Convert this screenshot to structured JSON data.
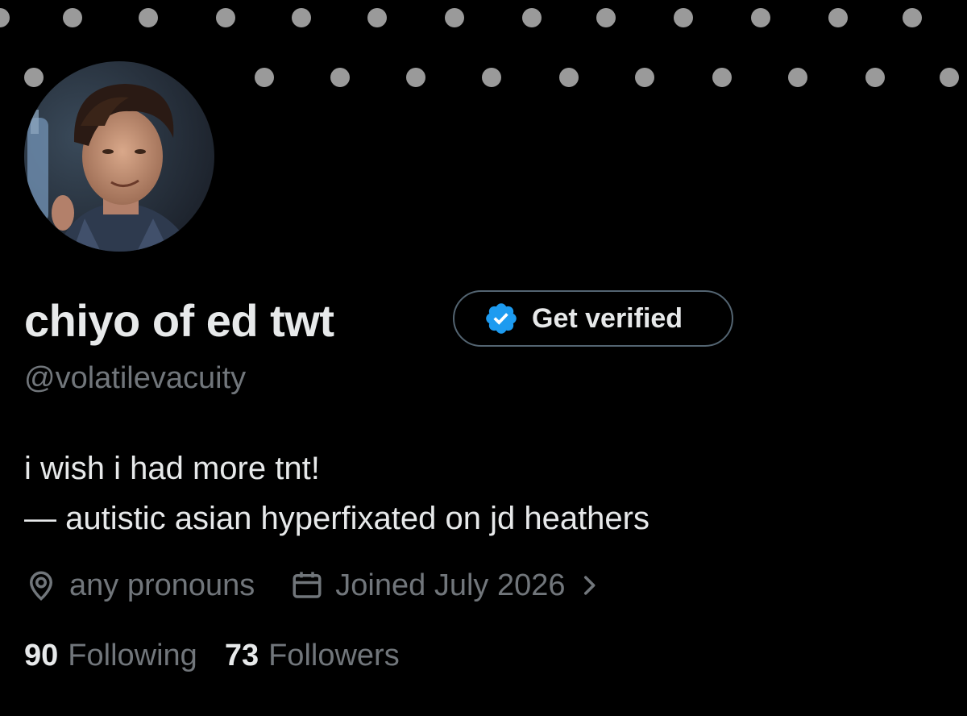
{
  "profile": {
    "display_name": "chiyo of ed twt",
    "handle": "@volatilevacuity",
    "verify_button_label": "Get verified",
    "bio_line_1": "i wish i had more tnt!",
    "bio_line_2": "— autistic asian hyperfixated on jd heathers",
    "pronouns": "any pronouns",
    "joined": "Joined July 2026",
    "following_count": "90",
    "following_label": "Following",
    "followers_count": "73",
    "followers_label": "Followers"
  },
  "icons": {
    "location": "location-pin-icon",
    "calendar": "calendar-icon",
    "chevron": "chevron-right-icon",
    "verified": "verified-badge-icon"
  },
  "colors": {
    "background": "#000000",
    "primary_text": "#e7e9ea",
    "secondary_text": "#71767b",
    "verified_blue": "#1d9bf0",
    "banner_dots": "#9a9a9a"
  }
}
